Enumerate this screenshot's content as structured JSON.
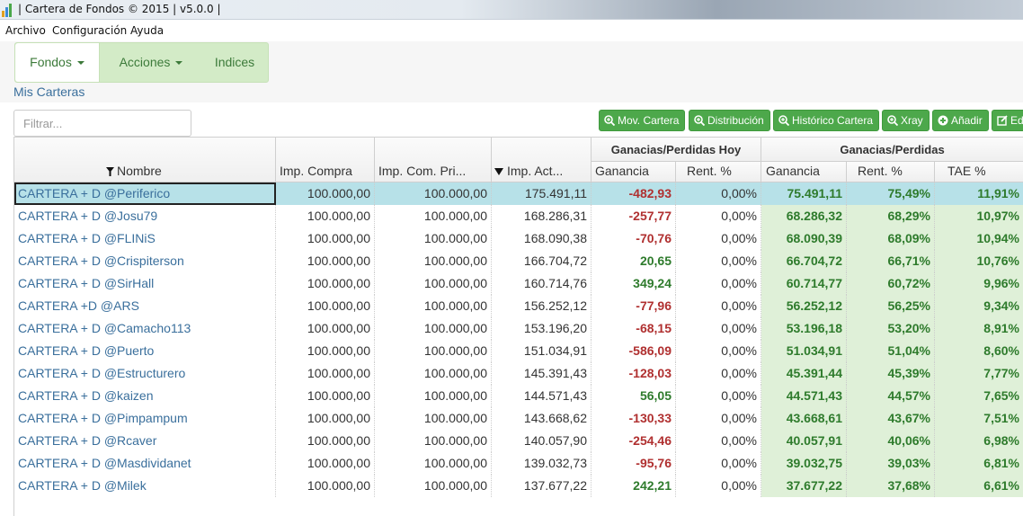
{
  "window": {
    "title": "| Cartera de Fondos © 2015 | v5.0.0 |"
  },
  "menu": [
    "Archivo",
    "Configuración",
    "Ayuda"
  ],
  "nav": {
    "tabs": [
      "Fondos",
      "Acciones",
      "Indices"
    ],
    "active": "Fondos"
  },
  "breadcrumb": "Mis Carteras",
  "filter": {
    "placeholder": "Filtrar...",
    "value": ""
  },
  "toolbar": {
    "buttons": [
      "Mov. Cartera",
      "Distribución",
      "Histórico Cartera",
      "Xray",
      "Añadir",
      "Ed"
    ]
  },
  "table": {
    "group_headers": [
      "Ganacias/Perdidas Hoy",
      "Ganacias/Perdidas"
    ],
    "columns": [
      "Nombre",
      "Imp. Compra",
      "Imp. Com. Pri...",
      "Imp. Act...",
      "Ganancia",
      "Rent. %",
      "Ganancia",
      "Rent. %",
      "TAE %"
    ],
    "rows": [
      [
        "CARTERA + D @Periferico",
        "100.000,00",
        "100.000,00",
        "175.491,11",
        "-482,93",
        "0,00%",
        "75.491,11",
        "75,49%",
        "11,91%"
      ],
      [
        "CARTERA + D @Josu79",
        "100.000,00",
        "100.000,00",
        "168.286,31",
        "-257,77",
        "0,00%",
        "68.286,32",
        "68,29%",
        "10,97%"
      ],
      [
        "CARTERA + D @FLINiS",
        "100.000,00",
        "100.000,00",
        "168.090,38",
        "-70,76",
        "0,00%",
        "68.090,39",
        "68,09%",
        "10,94%"
      ],
      [
        "CARTERA + D @Crispiterson",
        "100.000,00",
        "100.000,00",
        "166.704,72",
        "20,65",
        "0,00%",
        "66.704,72",
        "66,71%",
        "10,76%"
      ],
      [
        "CARTERA + D @SirHall",
        "100.000,00",
        "100.000,00",
        "160.714,76",
        "349,24",
        "0,00%",
        "60.714,77",
        "60,72%",
        "9,96%"
      ],
      [
        "CARTERA +D @ARS",
        "100.000,00",
        "100.000,00",
        "156.252,12",
        "-77,96",
        "0,00%",
        "56.252,12",
        "56,25%",
        "9,34%"
      ],
      [
        "CARTERA + D @Camacho113",
        "100.000,00",
        "100.000,00",
        "153.196,20",
        "-68,15",
        "0,00%",
        "53.196,18",
        "53,20%",
        "8,91%"
      ],
      [
        "CARTERA + D @Puerto",
        "100.000,00",
        "100.000,00",
        "151.034,91",
        "-586,09",
        "0,00%",
        "51.034,91",
        "51,04%",
        "8,60%"
      ],
      [
        "CARTERA + D @Estructurero",
        "100.000,00",
        "100.000,00",
        "145.391,43",
        "-128,03",
        "0,00%",
        "45.391,44",
        "45,39%",
        "7,77%"
      ],
      [
        "CARTERA + D @kaizen",
        "100.000,00",
        "100.000,00",
        "144.571,43",
        "56,05",
        "0,00%",
        "44.571,43",
        "44,57%",
        "7,65%"
      ],
      [
        "CARTERA + D @Pimpampum",
        "100.000,00",
        "100.000,00",
        "143.668,62",
        "-130,33",
        "0,00%",
        "43.668,61",
        "43,67%",
        "7,51%"
      ],
      [
        "CARTERA + D @Rcaver",
        "100.000,00",
        "100.000,00",
        "140.057,90",
        "-254,46",
        "0,00%",
        "40.057,91",
        "40,06%",
        "6,98%"
      ],
      [
        "CARTERA + D @Masdividanet",
        "100.000,00",
        "100.000,00",
        "139.032,73",
        "-95,76",
        "0,00%",
        "39.032,75",
        "39,03%",
        "6,81%"
      ],
      [
        "CARTERA + D @Milek",
        "100.000,00",
        "100.000,00",
        "137.677,22",
        "242,21",
        "0,00%",
        "37.677,22",
        "37,68%",
        "6,61%"
      ]
    ],
    "selected_row": 0
  },
  "colors": {
    "accent_green": "#4da84b",
    "nav_bg": "#d3ebc7",
    "link_blue": "#3a6f9c",
    "negative": "#b03030",
    "positive": "#2e7b2c",
    "selected_row": "#b7e1e8",
    "shaded_cells": "#dff0d8"
  }
}
